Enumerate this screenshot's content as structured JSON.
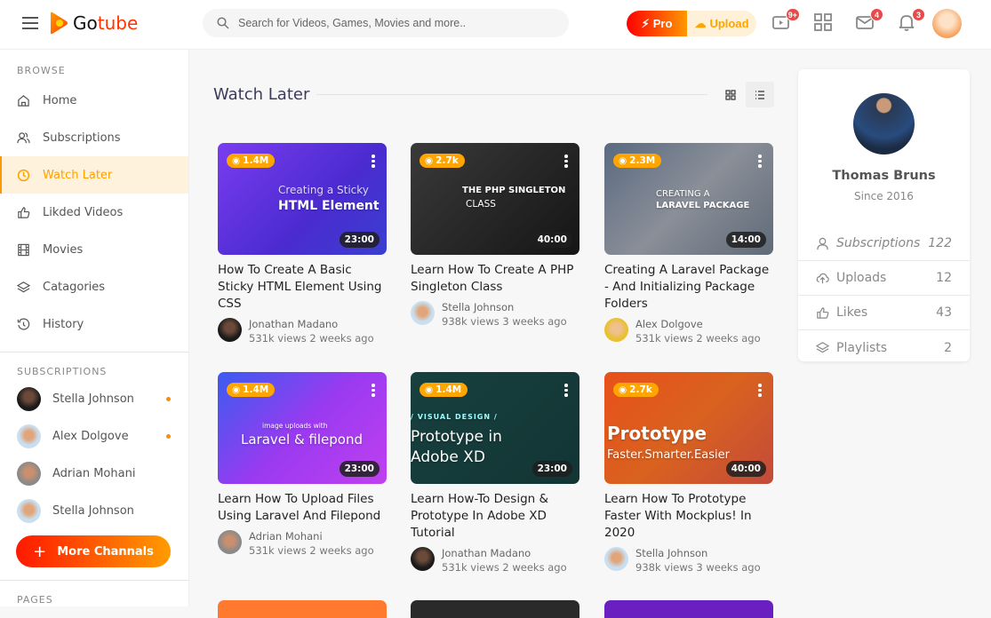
{
  "header": {
    "logo": {
      "part1": "Go",
      "part2": "tube"
    },
    "search_placeholder": "Search for Videos, Games, Movies and more..",
    "pro_label": "Pro",
    "upload_label": "Upload",
    "video_badge": "9+",
    "mail_badge": "4",
    "bell_badge": "3"
  },
  "sidebar": {
    "browse_title": "BROWSE",
    "items": [
      {
        "label": "Home",
        "icon": "home-icon"
      },
      {
        "label": "Subscriptions",
        "icon": "users-icon"
      },
      {
        "label": "Watch Later",
        "icon": "clock-icon",
        "active": true
      },
      {
        "label": "Likded Videos",
        "icon": "thumbs-up-icon"
      },
      {
        "label": "Movies",
        "icon": "film-icon"
      },
      {
        "label": "Catagories",
        "icon": "layers-icon"
      },
      {
        "label": "History",
        "icon": "history-icon"
      }
    ],
    "subscriptions_title": "SUBSCRIPTIONS",
    "subscriptions": [
      {
        "name": "Stella Johnson",
        "online": true
      },
      {
        "name": "Alex Dolgove",
        "online": true
      },
      {
        "name": "Adrian Mohani",
        "online": false
      },
      {
        "name": "Stella Johnson",
        "online": false
      }
    ],
    "more_button": "More Channals",
    "pages_title": "PAGES"
  },
  "main": {
    "title": "Watch Later",
    "videos": [
      {
        "views": "1.4M",
        "duration": "23:00",
        "title": "How To Create A Basic Sticky HTML Element Using CSS",
        "channel": "Jonathan Madano",
        "stats": "531k views 2 weeks ago",
        "thumb_text": [
          "Creating a Sticky",
          "HTML Element"
        ]
      },
      {
        "views": "2.7k",
        "duration": "40:00",
        "title": "Learn How To Create A PHP Singleton Class",
        "channel": "Stella Johnson",
        "stats": "938k views 3 weeks ago",
        "thumb_text": [
          "THE PHP SINGLETON",
          "CLASS"
        ]
      },
      {
        "views": "2.3M",
        "duration": "14:00",
        "title": "Creating A Laravel Package - And Initializing Package Folders",
        "channel": "Alex Dolgove",
        "stats": "531k views 2 weeks ago",
        "thumb_text": [
          "CREATING A",
          "LARAVEL PACKAGE"
        ]
      },
      {
        "views": "1.4M",
        "duration": "23:00",
        "title": "Learn How To Upload Files Using Laravel And Filepond",
        "channel": "Adrian Mohani",
        "stats": "531k views 2 weeks ago",
        "thumb_text": [
          "image uploads with",
          "Laravel & filepond"
        ]
      },
      {
        "views": "1.4M",
        "duration": "23:00",
        "title": "Learn How-To Design & Prototype In Adobe XD Tutorial",
        "channel": "Jonathan Madano",
        "stats": "531k views 2 weeks ago",
        "thumb_text": [
          "/ VISUAL DESIGN /",
          "Prototype in Adobe XD"
        ]
      },
      {
        "views": "2.7k",
        "duration": "40:00",
        "title": "Learn How To Prototype Faster With Mockplus! In 2020",
        "channel": "Stella Johnson",
        "stats": "938k views 3 weeks ago",
        "thumb_text": [
          "Prototype",
          "Faster.Smarter.Easier"
        ]
      }
    ]
  },
  "profile": {
    "name": "Thomas Bruns",
    "since": "Since 2016",
    "stats": [
      {
        "label": "Subscriptions",
        "value": "122",
        "icon": "user-icon"
      },
      {
        "label": "Uploads",
        "value": "12",
        "icon": "upload-icon"
      },
      {
        "label": "Likes",
        "value": "43",
        "icon": "thumbs-up-icon"
      },
      {
        "label": "Playlists",
        "value": "2",
        "icon": "layers-icon"
      }
    ]
  },
  "colors": {
    "accent": "#ffa500",
    "brand_red": "#ff3300",
    "badge": "#e84949"
  }
}
